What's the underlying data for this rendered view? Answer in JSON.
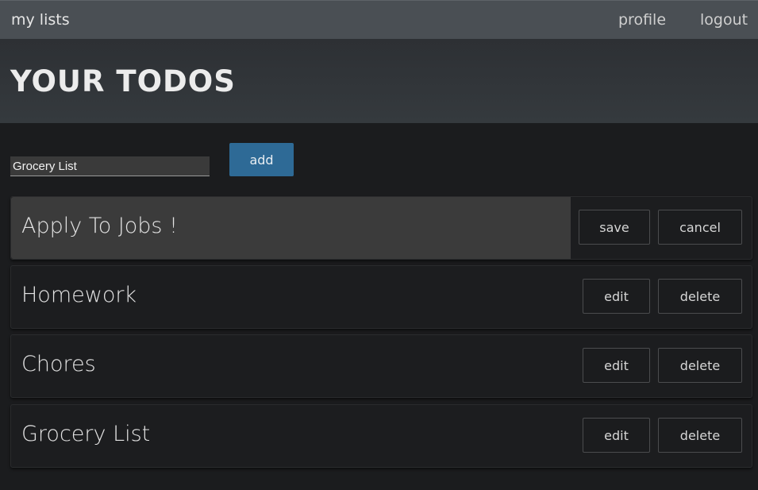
{
  "nav": {
    "brand": "my lists",
    "links": [
      "profile",
      "logout"
    ]
  },
  "header": {
    "title": "YOUR TODOS"
  },
  "new_item": {
    "value": "Grocery List",
    "add_label": "add"
  },
  "todos": [
    {
      "title": "Apply To Jobs !",
      "editing": true,
      "primary_label": "save",
      "secondary_label": "cancel"
    },
    {
      "title": "Homework",
      "editing": false,
      "primary_label": "edit",
      "secondary_label": "delete"
    },
    {
      "title": "Chores",
      "editing": false,
      "primary_label": "edit",
      "secondary_label": "delete"
    },
    {
      "title": "Grocery List",
      "editing": false,
      "primary_label": "edit",
      "secondary_label": "delete"
    }
  ],
  "colors": {
    "nav_bg": "#4a4f54",
    "header_bg": "#33373b",
    "page_bg": "#1b1c1e",
    "accent": "#2e6a96",
    "editing_row_bg": "#3b3b3b"
  }
}
